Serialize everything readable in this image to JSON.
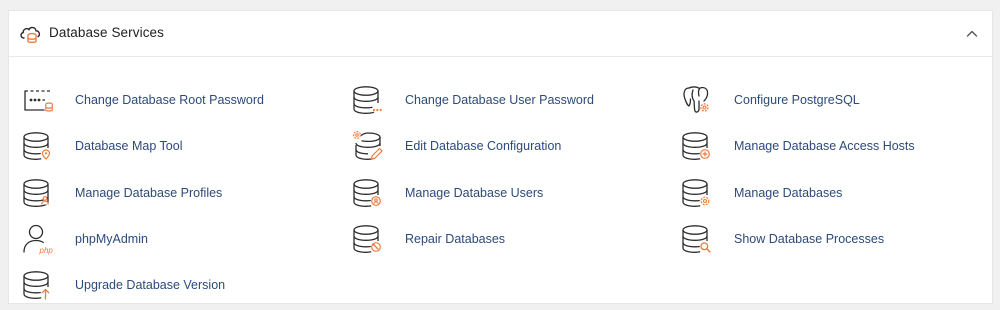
{
  "section": {
    "title": "Database Services",
    "icon": "database-services-icon",
    "collapse_icon": "chevron-up-icon"
  },
  "colors": {
    "link": "#2c4a7a",
    "icon_line": "#2d2d2d",
    "accent": "#f07b3f"
  },
  "items": [
    {
      "label": "Change Database Root Password",
      "icon": "terminal-password-icon"
    },
    {
      "label": "Change Database User Password",
      "icon": "database-password-icon"
    },
    {
      "label": "Configure PostgreSQL",
      "icon": "postgresql-gear-icon"
    },
    {
      "label": "Database Map Tool",
      "icon": "database-map-icon"
    },
    {
      "label": "Edit Database Configuration",
      "icon": "database-edit-config-icon"
    },
    {
      "label": "Manage Database Access Hosts",
      "icon": "database-access-hosts-icon"
    },
    {
      "label": "Manage Database Profiles",
      "icon": "database-profiles-icon"
    },
    {
      "label": "Manage Database Users",
      "icon": "database-users-icon"
    },
    {
      "label": "Manage Databases",
      "icon": "database-gear-icon"
    },
    {
      "label": "phpMyAdmin",
      "icon": "phpmyadmin-icon",
      "icon_text": "php"
    },
    {
      "label": "Repair Databases",
      "icon": "database-repair-icon"
    },
    {
      "label": "Show Database Processes",
      "icon": "database-search-icon"
    },
    {
      "label": "Upgrade Database Version",
      "icon": "database-upgrade-icon"
    }
  ]
}
